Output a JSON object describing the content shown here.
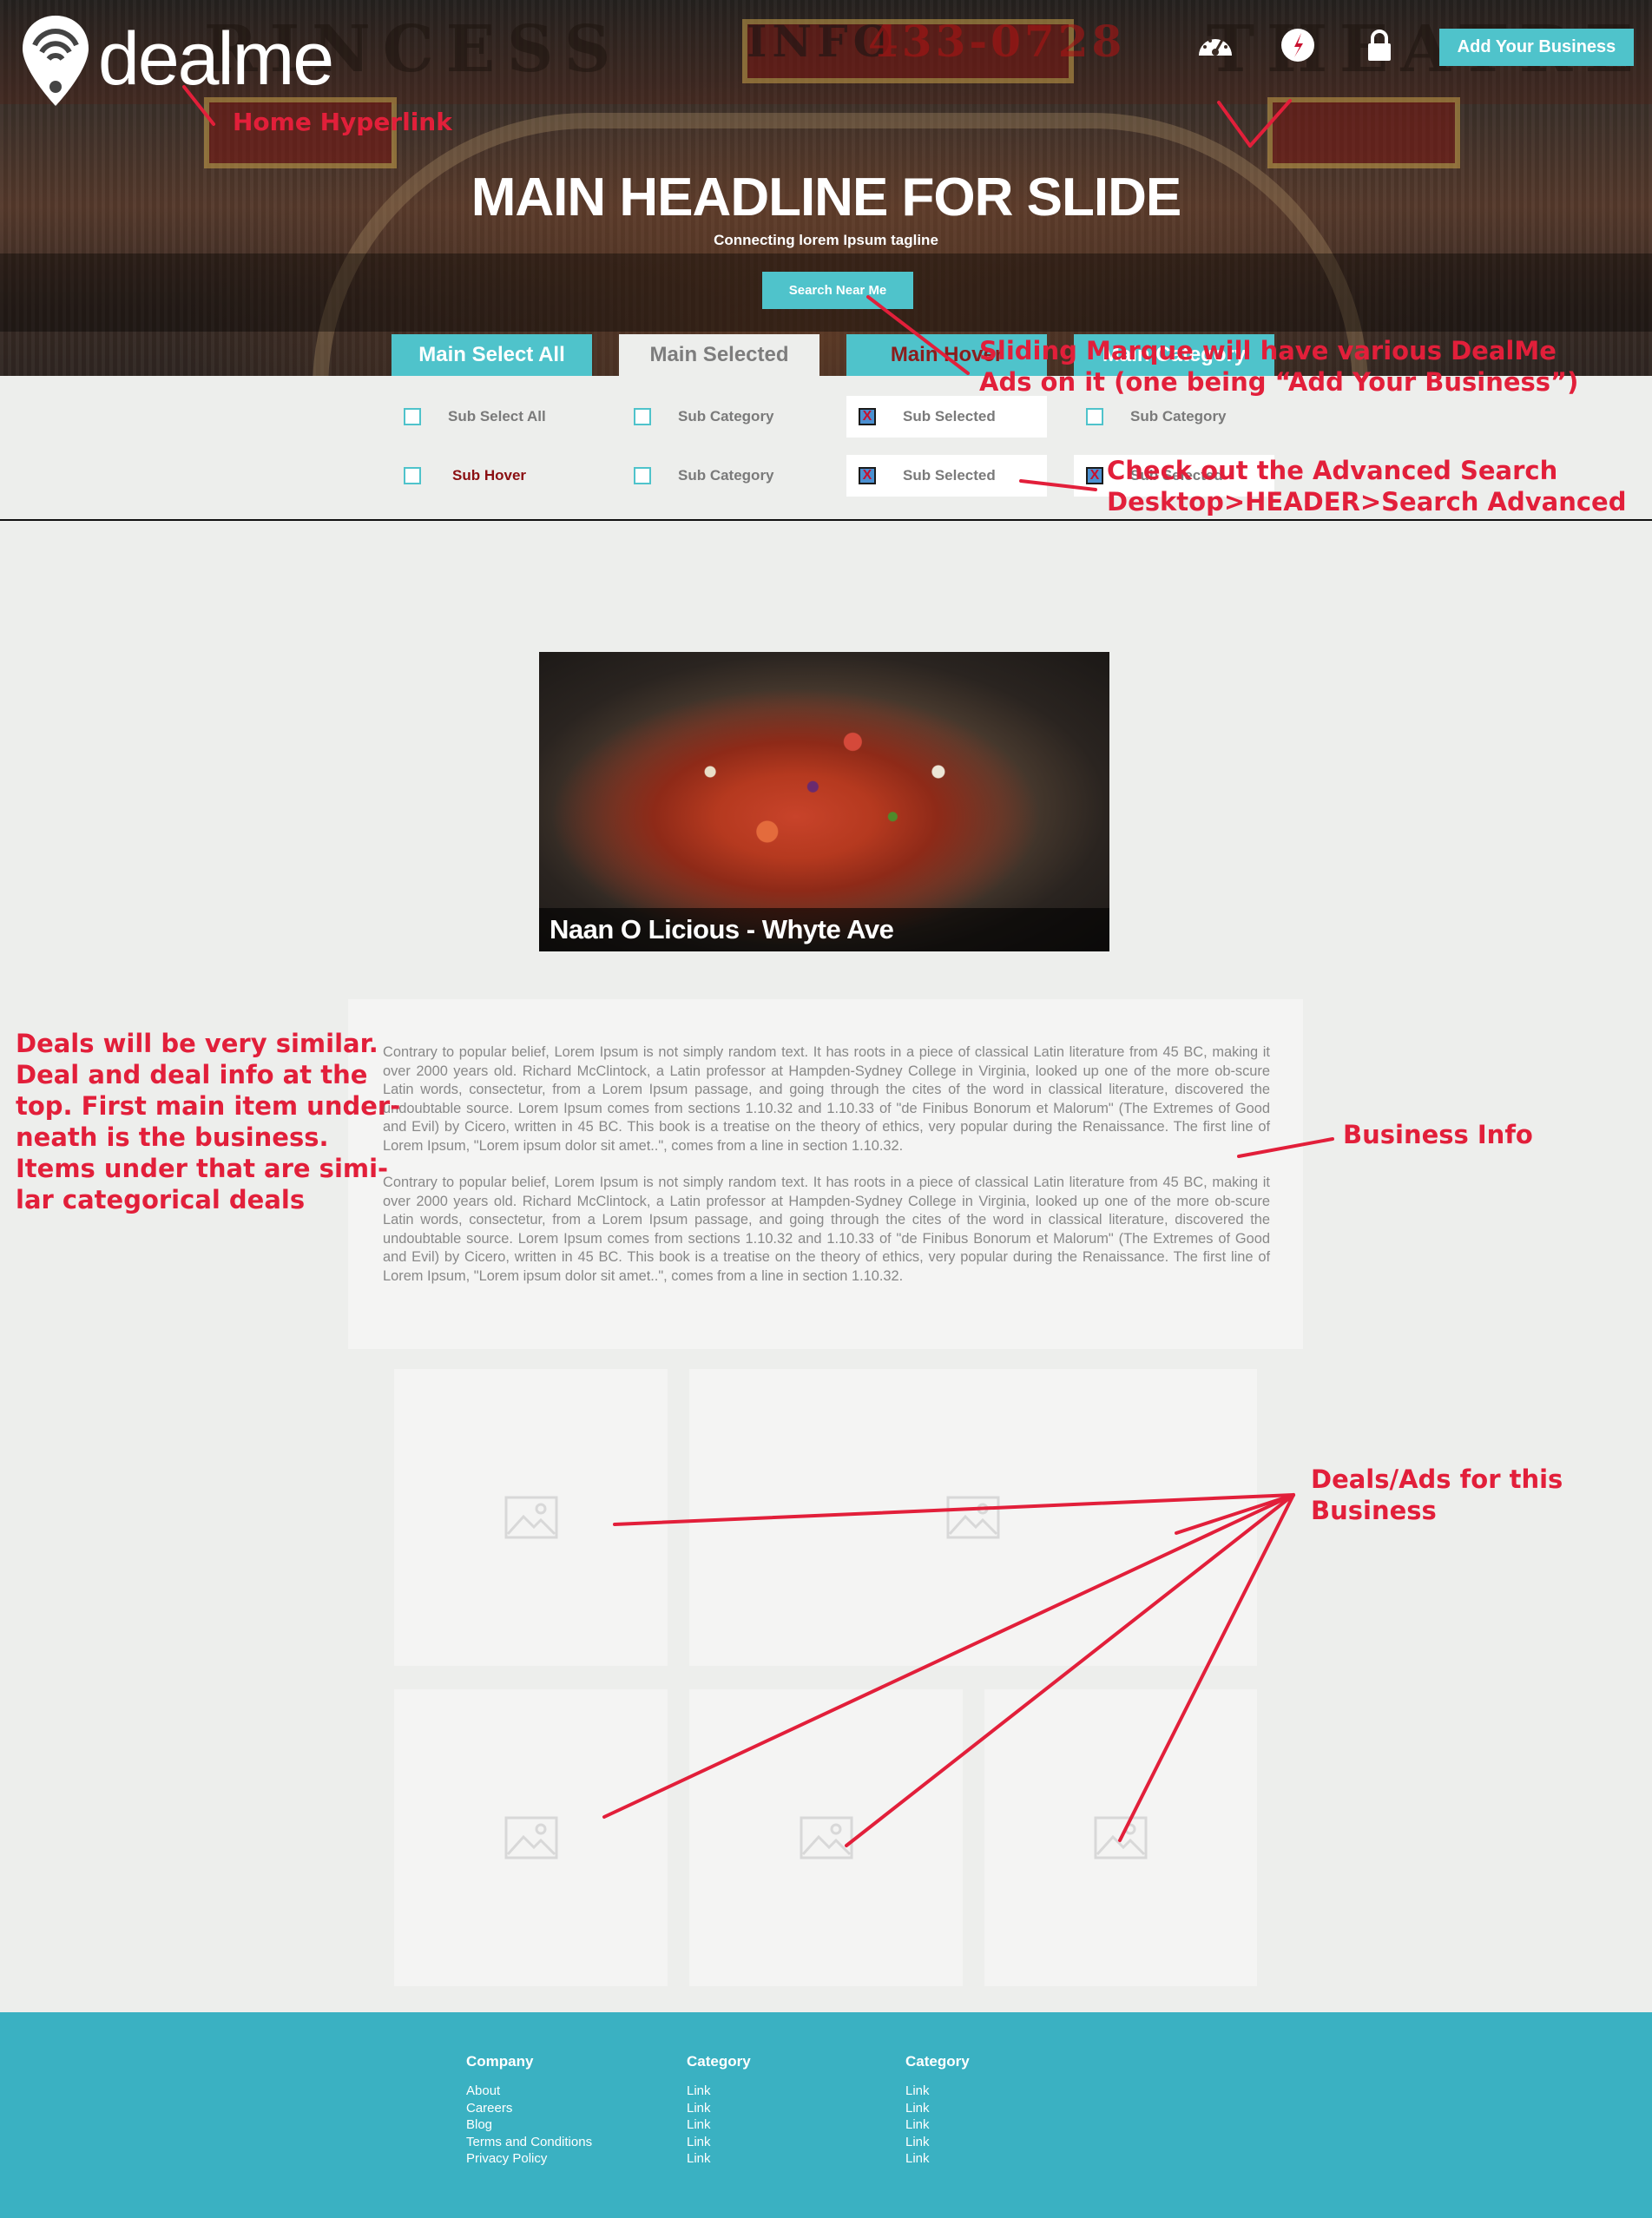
{
  "header": {
    "logo_text": "dealme",
    "add_business": "Add Your Business",
    "icons": [
      "dashboard-icon",
      "compass-icon",
      "lock-icon"
    ],
    "marquee_words": [
      "RINCESS",
      "INFO",
      "433-0728",
      "THEATRE"
    ]
  },
  "hero": {
    "headline": "MAIN HEADLINE FOR SLIDE",
    "tagline": "Connecting lorem Ipsum tagline",
    "search_button": "Search Near Me"
  },
  "tabs": [
    {
      "label": "Main Select All"
    },
    {
      "label": "Main Selected"
    },
    {
      "label": "Main Hover"
    },
    {
      "label": "Main Category"
    }
  ],
  "subs": {
    "row1": [
      {
        "label": "Sub Select All",
        "checked": false
      },
      {
        "label": "Sub Category",
        "checked": false
      },
      {
        "label": "Sub Selected",
        "checked": true
      },
      {
        "label": "Sub Category",
        "checked": false
      }
    ],
    "row2": [
      {
        "label": "Sub Hover",
        "checked": false
      },
      {
        "label": "Sub Category",
        "checked": false
      },
      {
        "label": "Sub Selected",
        "checked": true
      },
      {
        "label": "Sub Selected",
        "checked": true
      }
    ]
  },
  "feature": {
    "title": "Naan O Licious - Whyte Ave"
  },
  "business_info": {
    "paragraphs": [
      "Contrary to popular belief, Lorem Ipsum is not simply random text. It has roots in a piece of classical Latin literature from 45 BC, making it over 2000 years old. Richard McClintock, a Latin professor at Hampden-Sydney College in Virginia, looked up one of the more ob-scure Latin words, consectetur, from a Lorem Ipsum passage, and going through the cites of the word in classical literature, discovered the undoubtable source. Lorem Ipsum comes from sections 1.10.32 and 1.10.33 of \"de Finibus Bonorum et Malorum\" (The Extremes of Good and Evil) by Cicero, written in 45 BC. This book is a treatise on the theory of ethics, very popular during the Renaissance. The first line of Lorem Ipsum, \"Lorem ipsum dolor sit amet..\", comes from a line in section 1.10.32.",
      "Contrary to popular belief, Lorem Ipsum is not simply random text. It has roots in a piece of classical Latin literature from 45 BC, making it over 2000 years old. Richard McClintock, a Latin professor at Hampden-Sydney College in Virginia, looked up one of the more ob-scure Latin words, consectetur, from a Lorem Ipsum passage, and going through the cites of the word in classical literature, discovered the undoubtable source. Lorem Ipsum comes from sections 1.10.32 and 1.10.33 of \"de Finibus Bonorum et Malorum\" (The Extremes of Good and Evil) by Cicero, written in 45 BC. This book is a treatise on the theory of ethics, very popular during the Renaissance. The first line of Lorem Ipsum, \"Lorem ipsum dolor sit amet..\", comes from a line in section 1.10.32."
    ]
  },
  "annotations": {
    "home": "Home Hyperlink",
    "marquee_1": "Sliding Marque will have various DealMe",
    "marquee_2": "Ads on it (one being “Add Your Business”)",
    "adv_1": "Check out the Advanced Search",
    "adv_2": "Desktop>HEADER>Search Advanced",
    "deals_note": [
      "Deals will be very similar.",
      "Deal and deal info at the",
      "top. First main item under-",
      "neath is the business.",
      "Items under that are simi-",
      "lar categorical deals"
    ],
    "business_info": "Business Info",
    "deals_ads_1": "Deals/Ads for this",
    "deals_ads_2": "Business"
  },
  "footer": {
    "columns": [
      {
        "heading": "Company",
        "links": [
          "About",
          "Careers",
          "Blog",
          "Terms and Conditions",
          "Privacy Policy"
        ]
      },
      {
        "heading": "Category",
        "links": [
          "Link",
          "Link",
          "Link",
          "Link",
          "Link"
        ]
      },
      {
        "heading": "Category",
        "links": [
          "Link",
          "Link",
          "Link",
          "Link",
          "Link"
        ]
      }
    ]
  },
  "colors": {
    "teal": "#4fc3cb",
    "footer": "#3ab1c2",
    "annotation": "#e21f3a",
    "page_bg": "#edeeec"
  }
}
